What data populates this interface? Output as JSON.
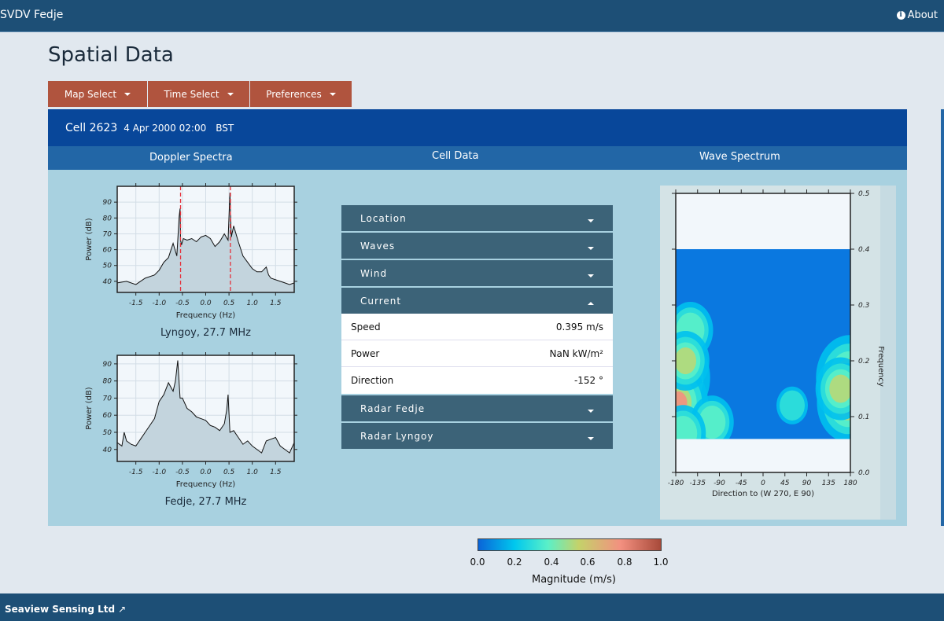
{
  "navbar": {
    "brand": "SVDV Fedje",
    "about_label": "About",
    "about_icon": "info-circle-icon"
  },
  "page": {
    "title": "Spatial Data"
  },
  "tabs": [
    {
      "label": "Map Select"
    },
    {
      "label": "Time Select"
    },
    {
      "label": "Preferences"
    }
  ],
  "cell": {
    "name": "Cell 2623",
    "time": "4 Apr 2000 02:00",
    "timezone": "BST"
  },
  "sections": {
    "doppler": "Doppler Spectra",
    "cell_data": "Cell Data",
    "wave": "Wave Spectrum"
  },
  "accordion": {
    "items": [
      {
        "label": "Location",
        "expanded": false
      },
      {
        "label": "Waves",
        "expanded": false
      },
      {
        "label": "Wind",
        "expanded": false
      },
      {
        "label": "Current",
        "expanded": true,
        "rows": [
          {
            "label": "Speed",
            "value": "0.395 m/s"
          },
          {
            "label": "Power",
            "value": "NaN kW/m²"
          },
          {
            "label": "Direction",
            "value": "-152 °"
          }
        ]
      },
      {
        "label": "Radar Fedje",
        "expanded": false
      },
      {
        "label": "Radar Lyngoy",
        "expanded": false
      }
    ]
  },
  "colorbar": {
    "title": "Magnitude (m/s)",
    "ticks": [
      "0.0",
      "0.2",
      "0.4",
      "0.6",
      "0.8",
      "1.0"
    ],
    "colors": [
      "#0a64d8",
      "#00c8ee",
      "#5af0c8",
      "#c4d26a",
      "#f39080",
      "#a84a3a"
    ]
  },
  "footer": {
    "company": "Seaview Sensing Ltd",
    "link_icon": "external-link-icon"
  },
  "chart_data": [
    {
      "type": "area",
      "title": "Lyngoy, 27.7 MHz",
      "xlabel": "Frequency (Hz)",
      "ylabel": "Power (dB)",
      "xlim": [
        -1.9,
        1.9
      ],
      "ylim": [
        33,
        100
      ],
      "xticks": [
        "-1.5",
        "-1.0",
        "-0.5",
        "0.0",
        "0.5",
        "1.0",
        "1.5"
      ],
      "yticks": [
        "40",
        "50",
        "60",
        "70",
        "80",
        "90"
      ],
      "vlines": [
        -0.54,
        0.53
      ],
      "x": [
        -1.9,
        -1.7,
        -1.5,
        -1.3,
        -1.1,
        -1.0,
        -0.9,
        -0.8,
        -0.7,
        -0.62,
        -0.57,
        -0.55,
        -0.54,
        -0.52,
        -0.48,
        -0.4,
        -0.3,
        -0.2,
        -0.1,
        0.0,
        0.1,
        0.2,
        0.3,
        0.4,
        0.48,
        0.52,
        0.53,
        0.55,
        0.6,
        0.65,
        0.7,
        0.8,
        0.9,
        1.0,
        1.1,
        1.2,
        1.3,
        1.35,
        1.4,
        1.5,
        1.6,
        1.7,
        1.8,
        1.9
      ],
      "y": [
        39,
        40,
        38,
        42,
        44,
        47,
        52,
        55,
        64,
        56,
        81,
        86,
        66,
        63,
        67,
        66,
        67,
        65,
        68,
        69,
        67,
        62,
        65,
        70,
        66,
        96,
        85,
        68,
        75,
        70,
        65,
        56,
        52,
        48,
        46,
        46,
        49,
        44,
        42,
        41,
        40,
        39,
        38,
        39
      ]
    },
    {
      "type": "area",
      "title": "Fedje, 27.7 MHz",
      "xlabel": "Frequency (Hz)",
      "ylabel": "Power (dB)",
      "xlim": [
        -1.9,
        1.9
      ],
      "ylim": [
        33,
        95
      ],
      "xticks": [
        "-1.5",
        "-1.0",
        "-0.5",
        "0.0",
        "0.5",
        "1.0",
        "1.5"
      ],
      "yticks": [
        "40",
        "50",
        "60",
        "70",
        "80",
        "90"
      ],
      "x": [
        -1.9,
        -1.8,
        -1.75,
        -1.7,
        -1.6,
        -1.5,
        -1.4,
        -1.3,
        -1.2,
        -1.1,
        -1.0,
        -0.9,
        -0.8,
        -0.7,
        -0.65,
        -0.6,
        -0.55,
        -0.5,
        -0.4,
        -0.3,
        -0.2,
        -0.1,
        0.0,
        0.1,
        0.2,
        0.3,
        0.4,
        0.45,
        0.48,
        0.52,
        0.6,
        0.7,
        0.8,
        0.9,
        1.0,
        1.1,
        1.2,
        1.3,
        1.4,
        1.5,
        1.6,
        1.7,
        1.8,
        1.9
      ],
      "y": [
        44,
        42,
        50,
        45,
        43,
        42,
        46,
        50,
        54,
        58,
        68,
        72,
        79,
        74,
        80,
        92,
        70,
        70,
        64,
        62,
        59,
        58,
        57,
        54,
        53,
        51,
        55,
        63,
        72,
        50,
        51,
        47,
        43,
        45,
        42,
        40,
        38,
        45,
        46,
        47,
        42,
        40,
        38,
        44
      ]
    },
    {
      "type": "heatmap",
      "title": "Wave Spectrum",
      "xlabel": "Direction to (W 270, E 90)",
      "ylabel": "Frequency",
      "xlim": [
        -180,
        180
      ],
      "ylim": [
        0.0,
        0.5
      ],
      "xticks": [
        "-180",
        "-135",
        "-90",
        "-45",
        "0",
        "45",
        "90",
        "135",
        "180"
      ],
      "yticks": [
        "0.0",
        "0.1",
        "0.2",
        "0.3",
        "0.4",
        "0.5"
      ],
      "data_frequency_range": [
        0.06,
        0.4
      ],
      "blobs": [
        {
          "dir": -178,
          "freq": 0.17,
          "mag": 0.95
        },
        {
          "dir": -175,
          "freq": 0.125,
          "mag": 0.8
        },
        {
          "dir": -150,
          "freq": 0.255,
          "mag": 0.5
        },
        {
          "dir": -160,
          "freq": 0.2,
          "mag": 0.55
        },
        {
          "dir": -105,
          "freq": 0.09,
          "mag": 0.45
        },
        {
          "dir": -165,
          "freq": 0.07,
          "mag": 0.5
        },
        {
          "dir": 178,
          "freq": 0.17,
          "mag": 0.95
        },
        {
          "dir": 175,
          "freq": 0.125,
          "mag": 0.85
        },
        {
          "dir": 160,
          "freq": 0.15,
          "mag": 0.6
        },
        {
          "dir": 60,
          "freq": 0.12,
          "mag": 0.2
        }
      ]
    }
  ]
}
